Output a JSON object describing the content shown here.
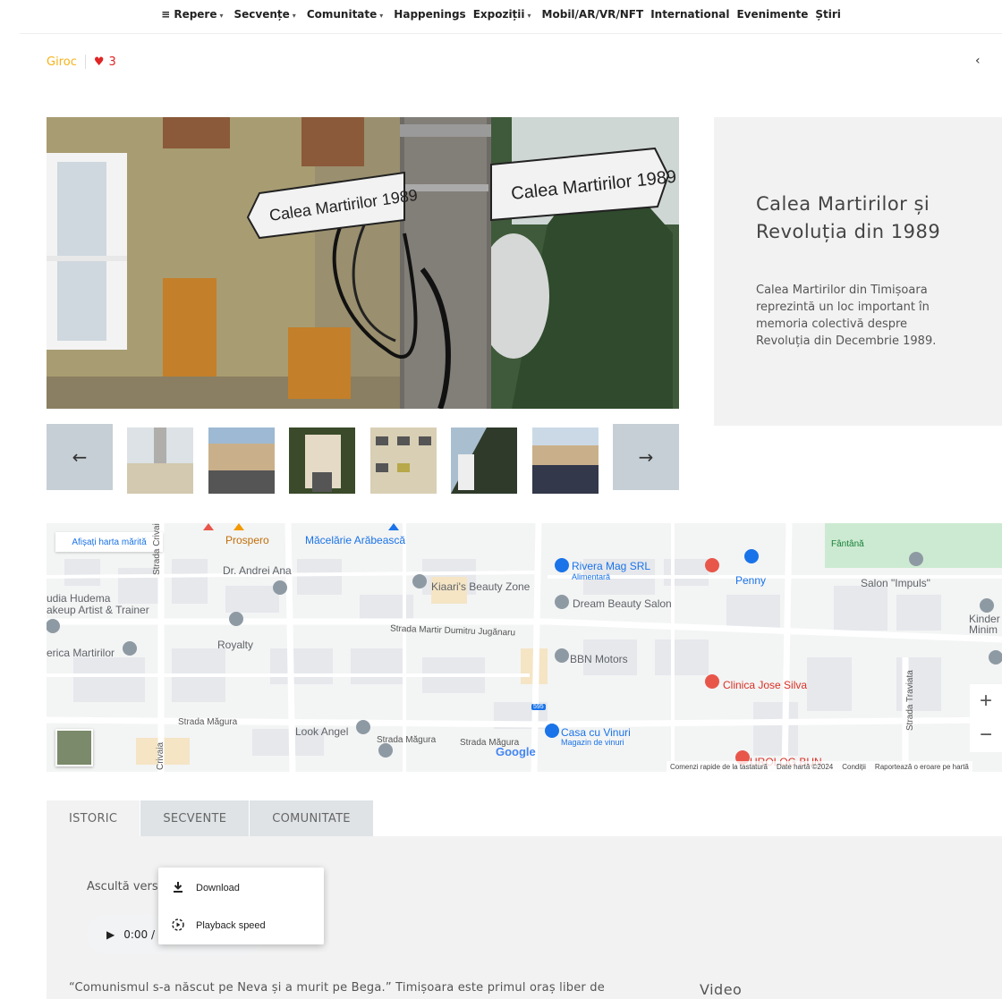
{
  "nav": {
    "items": [
      {
        "label": "≡ Repere",
        "caret": true
      },
      {
        "label": "Secvențe",
        "caret": true
      },
      {
        "label": "Comunitate",
        "caret": true
      },
      {
        "label": "Happenings",
        "caret": false
      },
      {
        "label": "Expoziții",
        "caret": true
      },
      {
        "label": "Mobil/AR/VR/NFT",
        "caret": false
      },
      {
        "label": "International",
        "caret": false
      },
      {
        "label": "Evenimente",
        "caret": false
      },
      {
        "label": "Știri",
        "caret": false
      }
    ],
    "caret_glyph": "▾"
  },
  "crumb": {
    "location": "Giroc",
    "heart": "♥",
    "likes": "3"
  },
  "pager": {
    "prev": "‹"
  },
  "hero": {
    "sign_left": "Calea Martirilor 1989",
    "sign_right": "Calea Martirilor 1989"
  },
  "info": {
    "title": "Calea Martirilor și Revoluția din 1989",
    "description": "Calea Martirilor din Timișoara reprezintă un loc important în memoria colectivă despre Revoluția din Decembrie 1989."
  },
  "gallery": {
    "prev_arrow": "←",
    "next_arrow": "→"
  },
  "map": {
    "enlarge": "Afișați harta mărită",
    "labels": [
      "Prospero",
      "Măcelărie Arăbească",
      "Dr. Andrei Ana",
      "Kiaari's Beauty Zone",
      "Rivera Mag SRL",
      "Alimentară",
      "Penny",
      "Salon \"Impuls\"",
      "Fântână",
      "Dream Beauty Salon",
      "udia Hudema",
      "akeup Artist & Trainer",
      "Royalty",
      "Strada Martir Dumitru Jugănaru",
      "erica Martirilor",
      "BBN Motors",
      "Kinder",
      "Minim",
      "Clinica Jose Silva",
      "Strada Măgura",
      "Look Angel",
      "Strada Măgura",
      "Strada Măgura",
      "Casa cu Vinuri",
      "Magazin de vinuri",
      "UROLOG BUN",
      "Strada Crivaia",
      "Crivaia",
      "Strada Traviata",
      "595"
    ],
    "google": "Google",
    "zoom_in": "+",
    "zoom_out": "−",
    "footer": [
      "Comenzi rapide de la tastatură",
      "Date hartă ©2024",
      "Condiții",
      "Raportează o eroare pe hartă"
    ]
  },
  "tabs": {
    "items": [
      "ISTORIC",
      "SECVENTE",
      "COMUNITATE"
    ]
  },
  "panel": {
    "listen": "Ascultă vers",
    "audio_time": "0:00 /",
    "play": "▶",
    "quote": "“Comunismul s-a născut pe Neva și a murit pe Bega.” Timișoara este primul oraș liber de",
    "video_label": "Video"
  },
  "menu": {
    "download": "Download",
    "playback": "Playback speed"
  }
}
